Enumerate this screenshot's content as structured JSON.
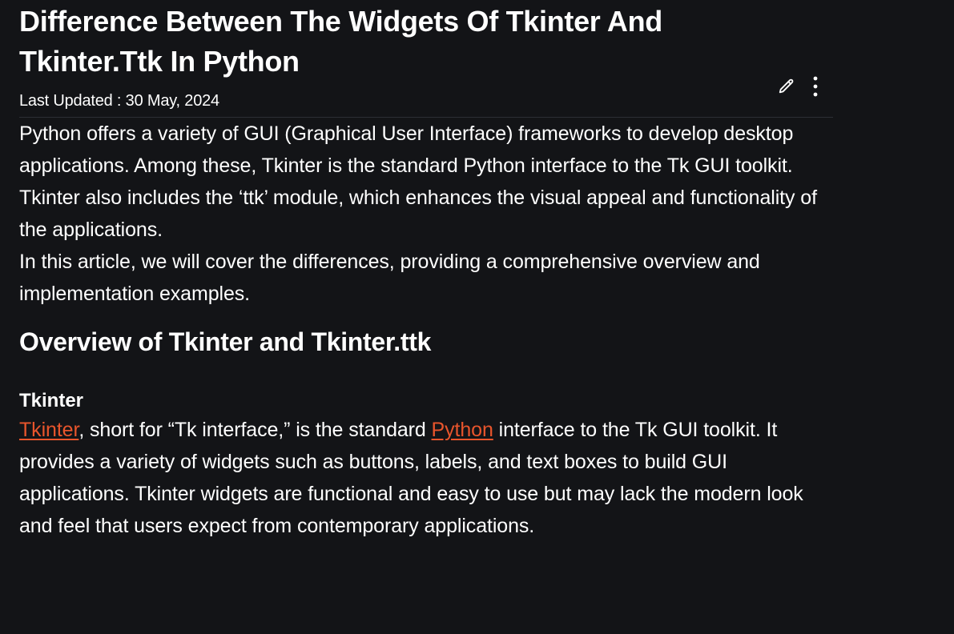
{
  "article": {
    "title": "Difference Between The Widgets Of Tkinter And Tkinter.Ttk In Python",
    "last_updated_label": "Last Updated : ",
    "last_updated_date": "30 May, 2024",
    "edit_icon": "pencil-icon",
    "more_icon": "kebab-menu-icon",
    "intro_paragraph": "Python offers a variety of GUI (Graphical User Interface) frameworks to develop desktop applications. Among these, Tkinter is the standard Python interface to the Tk GUI toolkit. Tkinter also includes the ‘ttk’ module, which enhances the visual appeal and functionality of the applications.",
    "scope_paragraph": "In this article, we will cover the differences, providing a comprehensive overview and implementation examples.",
    "section_heading": "Overview of Tkinter and Tkinter.ttk",
    "subheading": "Tkinter",
    "tkinter_paragraph": {
      "link_tkinter": "Tkinter",
      "text_1": ", short for “Tk interface,” is the standard ",
      "link_python": "Python",
      "text_2": " interface to the Tk GUI toolkit. It provides a variety of widgets such as buttons, labels, and text boxes to build GUI applications. Tkinter widgets are functional and easy to use but may lack the modern look and feel that users expect from contemporary applications."
    }
  },
  "colors": {
    "background": "#131417",
    "text": "#ffffff",
    "link": "#e8552c",
    "divider": "#2c2f34"
  }
}
